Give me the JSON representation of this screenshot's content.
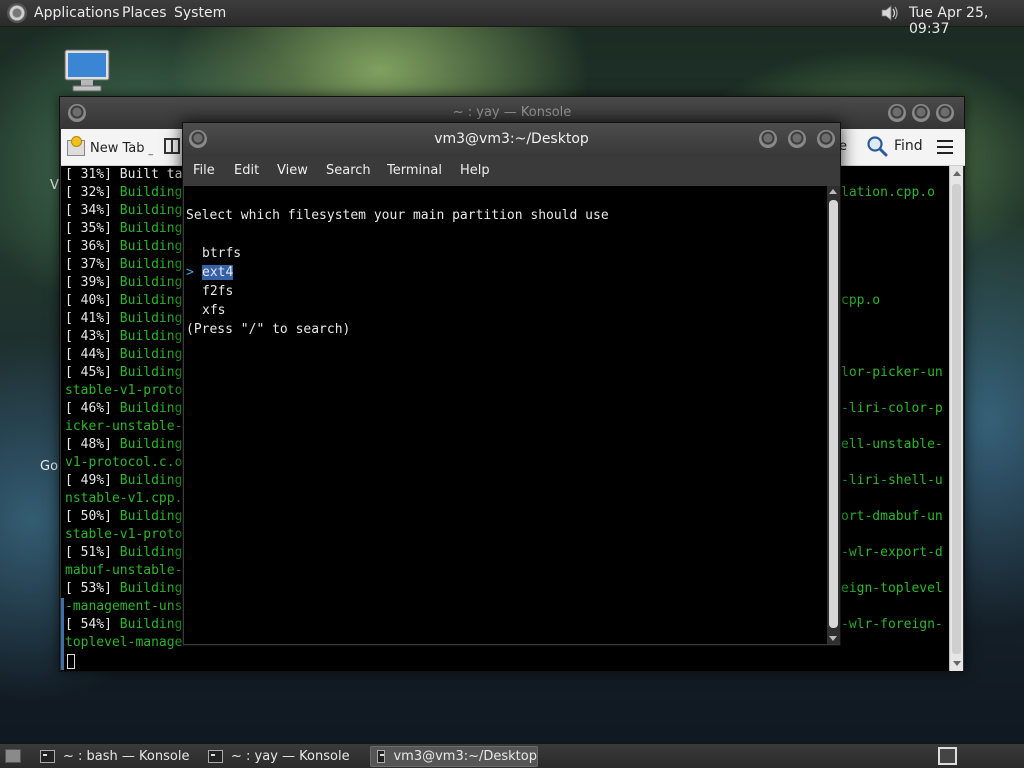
{
  "top_panel": {
    "menus": [
      "Applications",
      "Places",
      "System"
    ],
    "clock": "Tue Apr 25, 09:37",
    "icons": {
      "logo": "gnome-foot-icon",
      "volume": "volume-icon"
    }
  },
  "desktop": {
    "icon_labels": {
      "v": "V",
      "go": "Go"
    }
  },
  "konsole_back": {
    "title": "~ : yay — Konsole",
    "toolbar": {
      "new_tab": "New Tab",
      "new_tab_suffix": "_",
      "e_fragment": "e",
      "find": "Find"
    },
    "left_lines": [
      {
        "pct": "[ 31%]",
        "text": " Built ta",
        "green": false
      },
      {
        "pct": "[ 32%]",
        "text": " Building",
        "green": true
      },
      {
        "pct": "[ 34%]",
        "text": " Building",
        "green": true
      },
      {
        "pct": "[ 35%]",
        "text": " Building",
        "green": true
      },
      {
        "pct": "[ 36%]",
        "text": " Building",
        "green": true
      },
      {
        "pct": "[ 37%]",
        "text": " Building",
        "green": true
      },
      {
        "pct": "[ 39%]",
        "text": " Building",
        "green": true
      },
      {
        "pct": "[ 40%]",
        "text": " Building",
        "green": true
      },
      {
        "pct": "[ 41%]",
        "text": " Building",
        "green": true
      },
      {
        "pct": "[ 43%]",
        "text": " Building",
        "green": true
      },
      {
        "pct": "[ 44%]",
        "text": " Building",
        "green": true
      },
      {
        "pct": "[ 45%]",
        "text": " Building",
        "green": true
      },
      {
        "pct": "",
        "text": "stable-v1-proto",
        "green": true
      },
      {
        "pct": "[ 46%]",
        "text": " Building",
        "green": true
      },
      {
        "pct": "",
        "text": "icker-unstable-",
        "green": true
      },
      {
        "pct": "[ 48%]",
        "text": " Building",
        "green": true
      },
      {
        "pct": "",
        "text": "v1-protocol.c.o",
        "green": true
      },
      {
        "pct": "[ 49%]",
        "text": " Building",
        "green": true
      },
      {
        "pct": "",
        "text": "nstable-v1.cpp.",
        "green": true
      },
      {
        "pct": "[ 50%]",
        "text": " Building",
        "green": true
      },
      {
        "pct": "",
        "text": "stable-v1-proto",
        "green": true
      },
      {
        "pct": "[ 51%]",
        "text": " Building",
        "green": true
      },
      {
        "pct": "",
        "text": "mabuf-unstable-",
        "green": true
      },
      {
        "pct": "[ 53%]",
        "text": " Building",
        "green": true
      },
      {
        "pct": "",
        "text": "-management-uns",
        "green": true
      },
      {
        "pct": "[ 54%]",
        "text": " Building",
        "green": true
      },
      {
        "pct": "",
        "text": "toplevel-manage",
        "green": true
      }
    ],
    "right_lines": [
      "",
      "lation.cpp.o",
      "",
      "",
      "",
      "",
      "",
      "cpp.o",
      "",
      "",
      "",
      "lor-picker-un",
      "",
      "-liri-color-p",
      "",
      "ell-unstable-",
      "",
      "-liri-shell-u",
      "",
      "ort-dmabuf-un",
      "",
      "-wlr-export-d",
      "",
      "eign-toplevel",
      "",
      "-wlr-foreign-",
      ""
    ]
  },
  "terminal_front": {
    "title": "vm3@vm3:~/Desktop",
    "menu": [
      "File",
      "Edit",
      "View",
      "Search",
      "Terminal",
      "Help"
    ],
    "prompt": "Select which filesystem your main partition should use",
    "options": [
      "btrfs",
      "ext4",
      "f2fs",
      "xfs"
    ],
    "selected_index": 1,
    "cursor_glyph": ">",
    "hint": "(Press \"/\" to search)"
  },
  "bottom_panel": {
    "tasks": [
      {
        "label": "~ : bash — Konsole",
        "active": false
      },
      {
        "label": "~ : yay — Konsole",
        "active": false
      },
      {
        "label": "vm3@vm3:~/Desktop",
        "active": true
      }
    ]
  },
  "colors": {
    "terminal_green": "#2db52d",
    "selection_blue": "#3461a8",
    "arrow_cyan": "#4aa7d8"
  }
}
